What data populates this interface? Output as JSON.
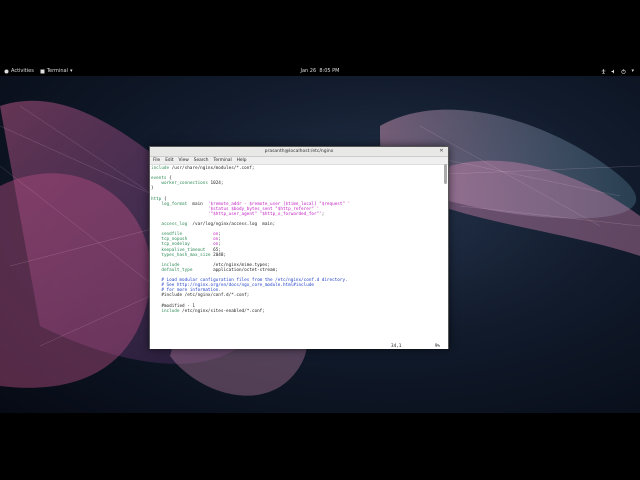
{
  "topbar": {
    "activities": "Activities",
    "app_menu": "Terminal",
    "date": "Jan 26",
    "time": "8:05 PM"
  },
  "terminal": {
    "title": "prasanth@localhost:/etc/nginx",
    "menu": [
      "File",
      "Edit",
      "View",
      "Search",
      "Terminal",
      "Help"
    ],
    "status_position": "34,1",
    "status_percent": "9%",
    "lines": [
      [
        [
          "kw",
          "include"
        ],
        [
          "t",
          " /usr/share/nginx/modules/*.conf;"
        ]
      ],
      [
        [
          "t",
          ""
        ]
      ],
      [
        [
          "kw",
          "events"
        ],
        [
          "t",
          " {"
        ]
      ],
      [
        [
          "t",
          "    "
        ],
        [
          "kw",
          "worker_connections"
        ],
        [
          "t",
          " 1024;"
        ]
      ],
      [
        [
          "t",
          "}"
        ]
      ],
      [
        [
          "t",
          ""
        ]
      ],
      [
        [
          "kw",
          "http"
        ],
        [
          "t",
          " {"
        ]
      ],
      [
        [
          "t",
          "    "
        ],
        [
          "kw",
          "log_format"
        ],
        [
          "t",
          "  main  "
        ],
        [
          "str",
          "'$remote_addr - $remote_user [$time_local] \"$request\" '"
        ]
      ],
      [
        [
          "t",
          "                      "
        ],
        [
          "str",
          "'$status $body_bytes_sent \"$http_referer\" '"
        ]
      ],
      [
        [
          "t",
          "                      "
        ],
        [
          "str",
          "'\"$http_user_agent\" \"$http_x_forwarded_for\"'"
        ],
        [
          "t",
          ";"
        ]
      ],
      [
        [
          "t",
          ""
        ]
      ],
      [
        [
          "t",
          "    "
        ],
        [
          "kw",
          "access_log"
        ],
        [
          "t",
          "  /var/log/nginx/access.log  main;"
        ]
      ],
      [
        [
          "t",
          ""
        ]
      ],
      [
        [
          "t",
          "    "
        ],
        [
          "kw",
          "sendfile"
        ],
        [
          "t",
          "            "
        ],
        [
          "num",
          "on"
        ],
        [
          "t",
          ";"
        ]
      ],
      [
        [
          "t",
          "    "
        ],
        [
          "kw",
          "tcp_nopush"
        ],
        [
          "t",
          "          "
        ],
        [
          "num",
          "on"
        ],
        [
          "t",
          ";"
        ]
      ],
      [
        [
          "t",
          "    "
        ],
        [
          "kw",
          "tcp_nodelay"
        ],
        [
          "t",
          "         "
        ],
        [
          "num",
          "on"
        ],
        [
          "t",
          ";"
        ]
      ],
      [
        [
          "t",
          "    "
        ],
        [
          "kw",
          "keepalive_timeout"
        ],
        [
          "t",
          "   65;"
        ]
      ],
      [
        [
          "t",
          "    "
        ],
        [
          "kw",
          "types_hash_max_size"
        ],
        [
          "t",
          " 2048;"
        ]
      ],
      [
        [
          "t",
          ""
        ]
      ],
      [
        [
          "t",
          "    "
        ],
        [
          "kw",
          "include"
        ],
        [
          "t",
          "             /etc/nginx/mime.types;"
        ]
      ],
      [
        [
          "t",
          "    "
        ],
        [
          "kw",
          "default_type"
        ],
        [
          "t",
          "        application/octet-stream;"
        ]
      ],
      [
        [
          "t",
          ""
        ]
      ],
      [
        [
          "t",
          "    "
        ],
        [
          "cm",
          "# Load modular configuration files from the /etc/nginx/conf.d directory."
        ]
      ],
      [
        [
          "t",
          "    "
        ],
        [
          "cm",
          "# See http://nginx.org/en/docs/ngx_core_module.html#include"
        ]
      ],
      [
        [
          "t",
          "    "
        ],
        [
          "cm",
          "# for more information."
        ]
      ],
      [
        [
          "t",
          "    #include /etc/nginx/conf.d/*.conf;"
        ]
      ],
      [
        [
          "t",
          ""
        ]
      ],
      [
        [
          "t",
          "    #modified - 1"
        ]
      ],
      [
        [
          "t",
          "    "
        ],
        [
          "kw",
          "include"
        ],
        [
          "t",
          " /etc/nginx/sites-enabled/*.conf;"
        ]
      ]
    ]
  },
  "colors": {
    "keyword": "#2e8b57",
    "string": "#c21ec2",
    "comment": "#1e3fc8"
  }
}
